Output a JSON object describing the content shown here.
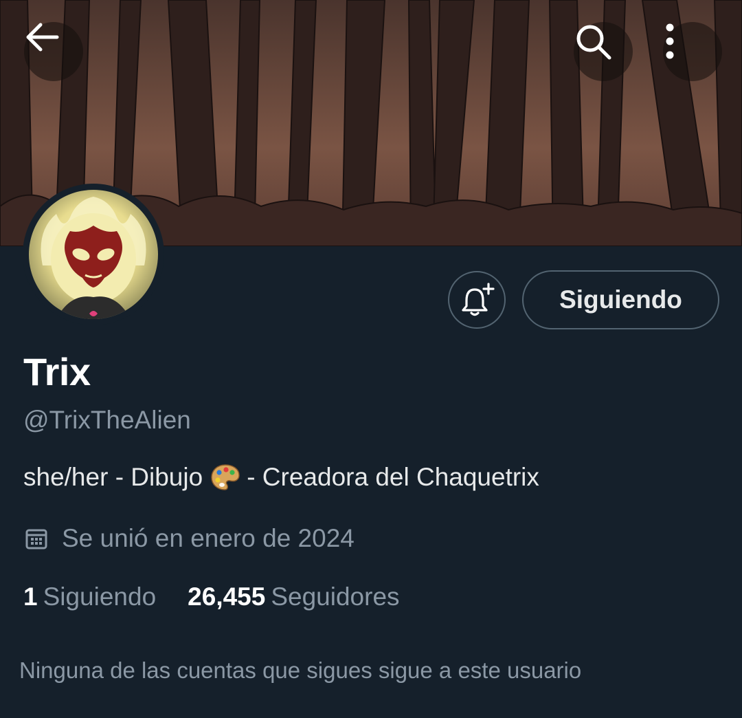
{
  "header": {
    "back_icon": "arrow-left-icon",
    "search_icon": "search-icon",
    "more_icon": "more-vertical-icon"
  },
  "banner": {
    "description_icon": "forest-banner-image"
  },
  "profile": {
    "display_name": "Trix",
    "handle": "@TrixTheAlien",
    "bio_before_emoji": "she/her - Dibujo",
    "bio_emoji": "🎨",
    "bio_after_emoji": "- Creadora del Chaquetrix",
    "joined": "Se unió en enero de 2024",
    "following_count": "1",
    "following_label": "Siguiendo",
    "followers_count": "26,455",
    "followers_label": "Seguidores",
    "mutuals_note": "Ninguna de las cuentas que sigues sigue a este usuario"
  },
  "actions": {
    "notify_icon": "bell-plus-icon",
    "follow_label": "Siguiendo"
  },
  "colors": {
    "background": "#15202b",
    "secondary_text": "#8b98a5",
    "border": "#536471"
  }
}
